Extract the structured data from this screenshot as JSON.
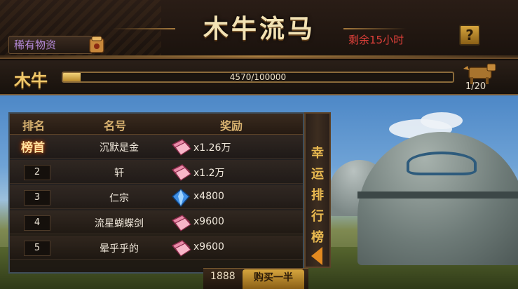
{
  "header": {
    "rare_tag": "稀有物资",
    "title": "木牛流马",
    "remaining": "剩余15小时",
    "help_label": "?"
  },
  "progress": {
    "label": "木牛",
    "text": "4570/100000",
    "current": 4570,
    "max": 100000,
    "ox_count": "1/20"
  },
  "board": {
    "columns": [
      "排名",
      "名号",
      "奖励"
    ],
    "rows": [
      {
        "rank": "榜首",
        "name": "沉默是金",
        "reward_icon": "pink-scroll-icon",
        "reward": "x1.26万"
      },
      {
        "rank": "2",
        "name": "轩",
        "reward_icon": "pink-scroll-icon",
        "reward": "x1.2万"
      },
      {
        "rank": "3",
        "name": "仁宗",
        "reward_icon": "blue-crystal-icon",
        "reward": "x4800"
      },
      {
        "rank": "4",
        "name": "流星蝴蝶剑",
        "reward_icon": "pink-scroll-icon",
        "reward": "x9600"
      },
      {
        "rank": "5",
        "name": "晕乎乎的",
        "reward_icon": "pink-scroll-icon",
        "reward": "x9600"
      }
    ]
  },
  "lucky_tab": {
    "chars": [
      "幸",
      "运",
      "排",
      "行",
      "榜"
    ]
  },
  "bottom": {
    "number": "1888",
    "button": "购买一半"
  },
  "colors": {
    "accent_gold": "#f0c86a",
    "remaining_red": "#e0403a",
    "rare_purple": "#b58ad9",
    "lucky_orange": "#e9b950"
  }
}
